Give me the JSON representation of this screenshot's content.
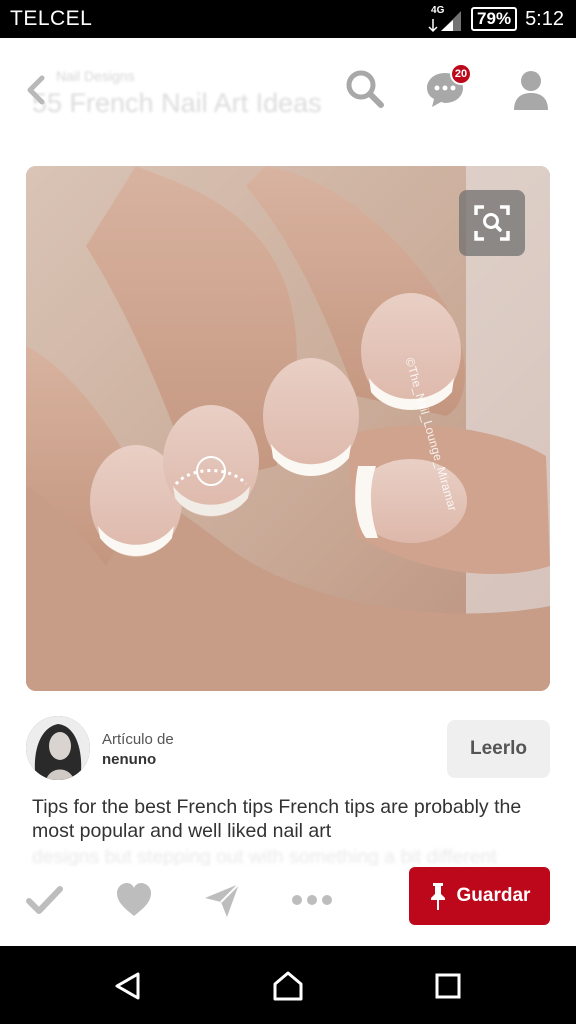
{
  "status_bar": {
    "carrier": "TELCEL",
    "network": "4G",
    "battery": "79%",
    "time": "5:12"
  },
  "header": {
    "subtitle": "Nail Designs",
    "title": "55 French Nail Art Ideas",
    "notification_count": "20",
    "icons": [
      "back-arrow-icon",
      "search-icon",
      "messages-icon",
      "profile-icon"
    ]
  },
  "pin": {
    "watermark": "©The_Nail_Lounge_Miramar"
  },
  "attribution": {
    "label": "Artículo de",
    "user": "nenuno",
    "read_button": "Leerlo"
  },
  "description": {
    "text": "Tips for the best French tips French tips are probably the most popular and well liked nail art",
    "faded_text": "designs but stepping out with something a bit different"
  },
  "actions": {
    "icons": [
      "check-icon",
      "heart-icon",
      "send-icon",
      "more-icon"
    ],
    "save_button": "Guardar",
    "save_color": "#bd081c"
  },
  "nav_bar": {
    "icons": [
      "back-triangle-icon",
      "home-icon",
      "recent-apps-icon"
    ]
  }
}
